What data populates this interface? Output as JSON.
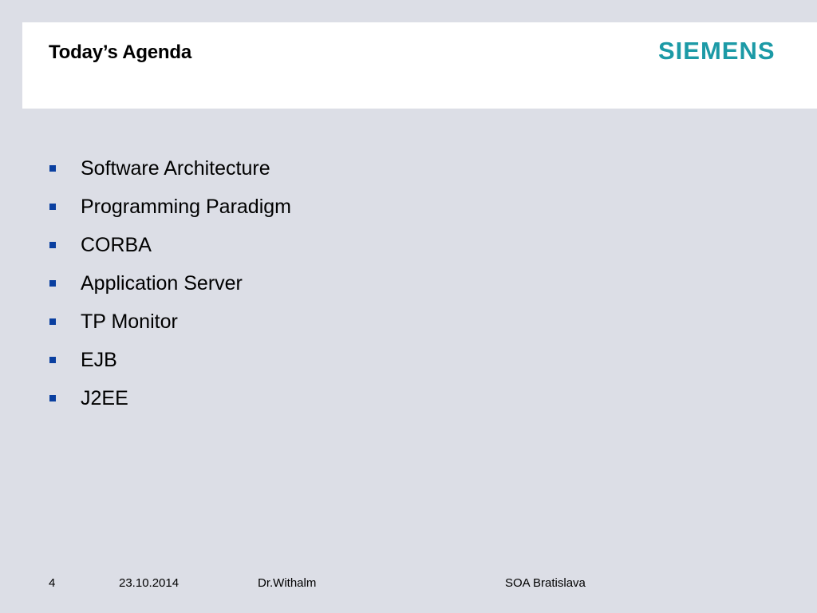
{
  "header": {
    "title": "Today’s Agenda",
    "logo_text": "SIEMENS",
    "logo_color": "#1c9aa6"
  },
  "agenda": {
    "bullet_color": "#0a3fa0",
    "items": [
      {
        "label": "Software Architecture"
      },
      {
        "label": "Programming Paradigm"
      },
      {
        "label": "CORBA"
      },
      {
        "label": "Application Server"
      },
      {
        "label": "TP Monitor"
      },
      {
        "label": "EJB"
      },
      {
        "label": "J2EE"
      }
    ]
  },
  "footer": {
    "page_number": "4",
    "date": "23.10.2014",
    "author": "Dr.Withalm",
    "event": "SOA Bratislava"
  }
}
